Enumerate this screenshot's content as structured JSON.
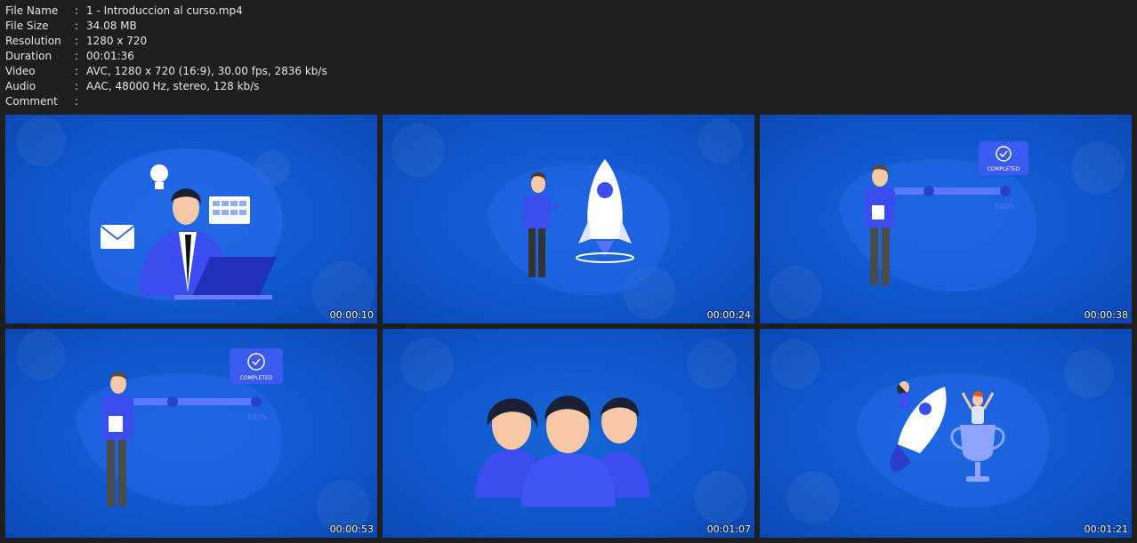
{
  "file_info": [
    {
      "key": "File Name",
      "value": "1 - Introduccion al curso.mp4"
    },
    {
      "key": "File Size",
      "value": "34.08 MB"
    },
    {
      "key": "Resolution",
      "value": "1280 x 720"
    },
    {
      "key": "Duration",
      "value": "00:01:36"
    },
    {
      "key": "Video",
      "value": "AVC, 1280 x 720 (16:9), 30.00 fps, 2836 kb/s"
    },
    {
      "key": "Audio",
      "value": "AAC, 48000 Hz, stereo, 128 kb/s"
    },
    {
      "key": "Comment",
      "value": ""
    }
  ],
  "separator": ":",
  "thumbnails": [
    {
      "timestamp": "00:00:10"
    },
    {
      "timestamp": "00:00:24"
    },
    {
      "timestamp": "00:00:38",
      "badge": "COMPLETED",
      "progress_label": "100%"
    },
    {
      "timestamp": "00:00:53",
      "badge": "COMPLETED",
      "progress_label": "100%"
    },
    {
      "timestamp": "00:01:07"
    },
    {
      "timestamp": "00:01:21"
    }
  ],
  "colors": {
    "background": "#1e1e1e",
    "thumb_blue": "#0f57cc",
    "figure_blue": "#3a4ef0"
  }
}
